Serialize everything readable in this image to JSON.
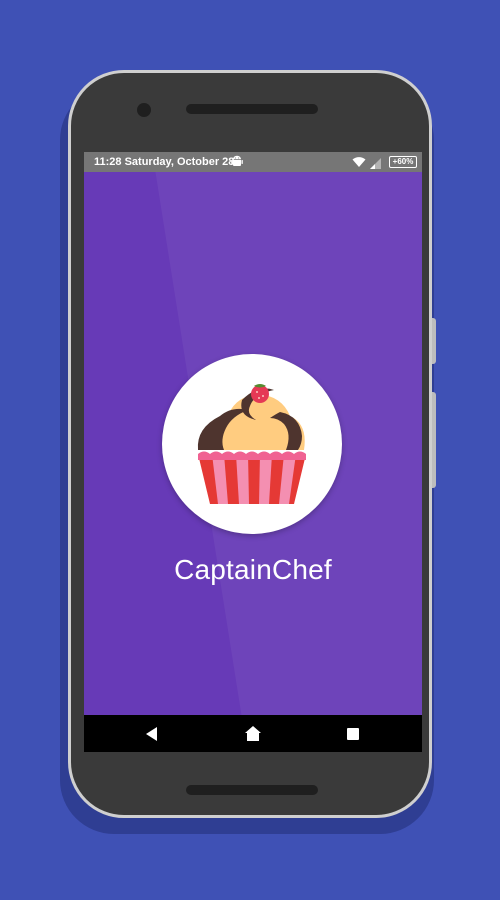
{
  "status_bar": {
    "time_date": "11:28 Saturday, October 28",
    "battery": "+60%",
    "icons": [
      "android-icon",
      "wifi-icon",
      "signal-icon",
      "battery-icon"
    ]
  },
  "app": {
    "name": "CaptainChef",
    "logo": "cupcake-logo-icon",
    "background_color": "#673ab7"
  },
  "nav_bar": {
    "buttons": [
      "back-icon",
      "home-icon",
      "recents-icon"
    ]
  },
  "colors": {
    "page_background": "#3f51b5",
    "accent_purple": "#673ab7",
    "cupcake_liner": "#e53935",
    "cupcake_frosting": "#ffcc80",
    "cupcake_chocolate": "#4e342e",
    "strawberry": "#e53955"
  }
}
